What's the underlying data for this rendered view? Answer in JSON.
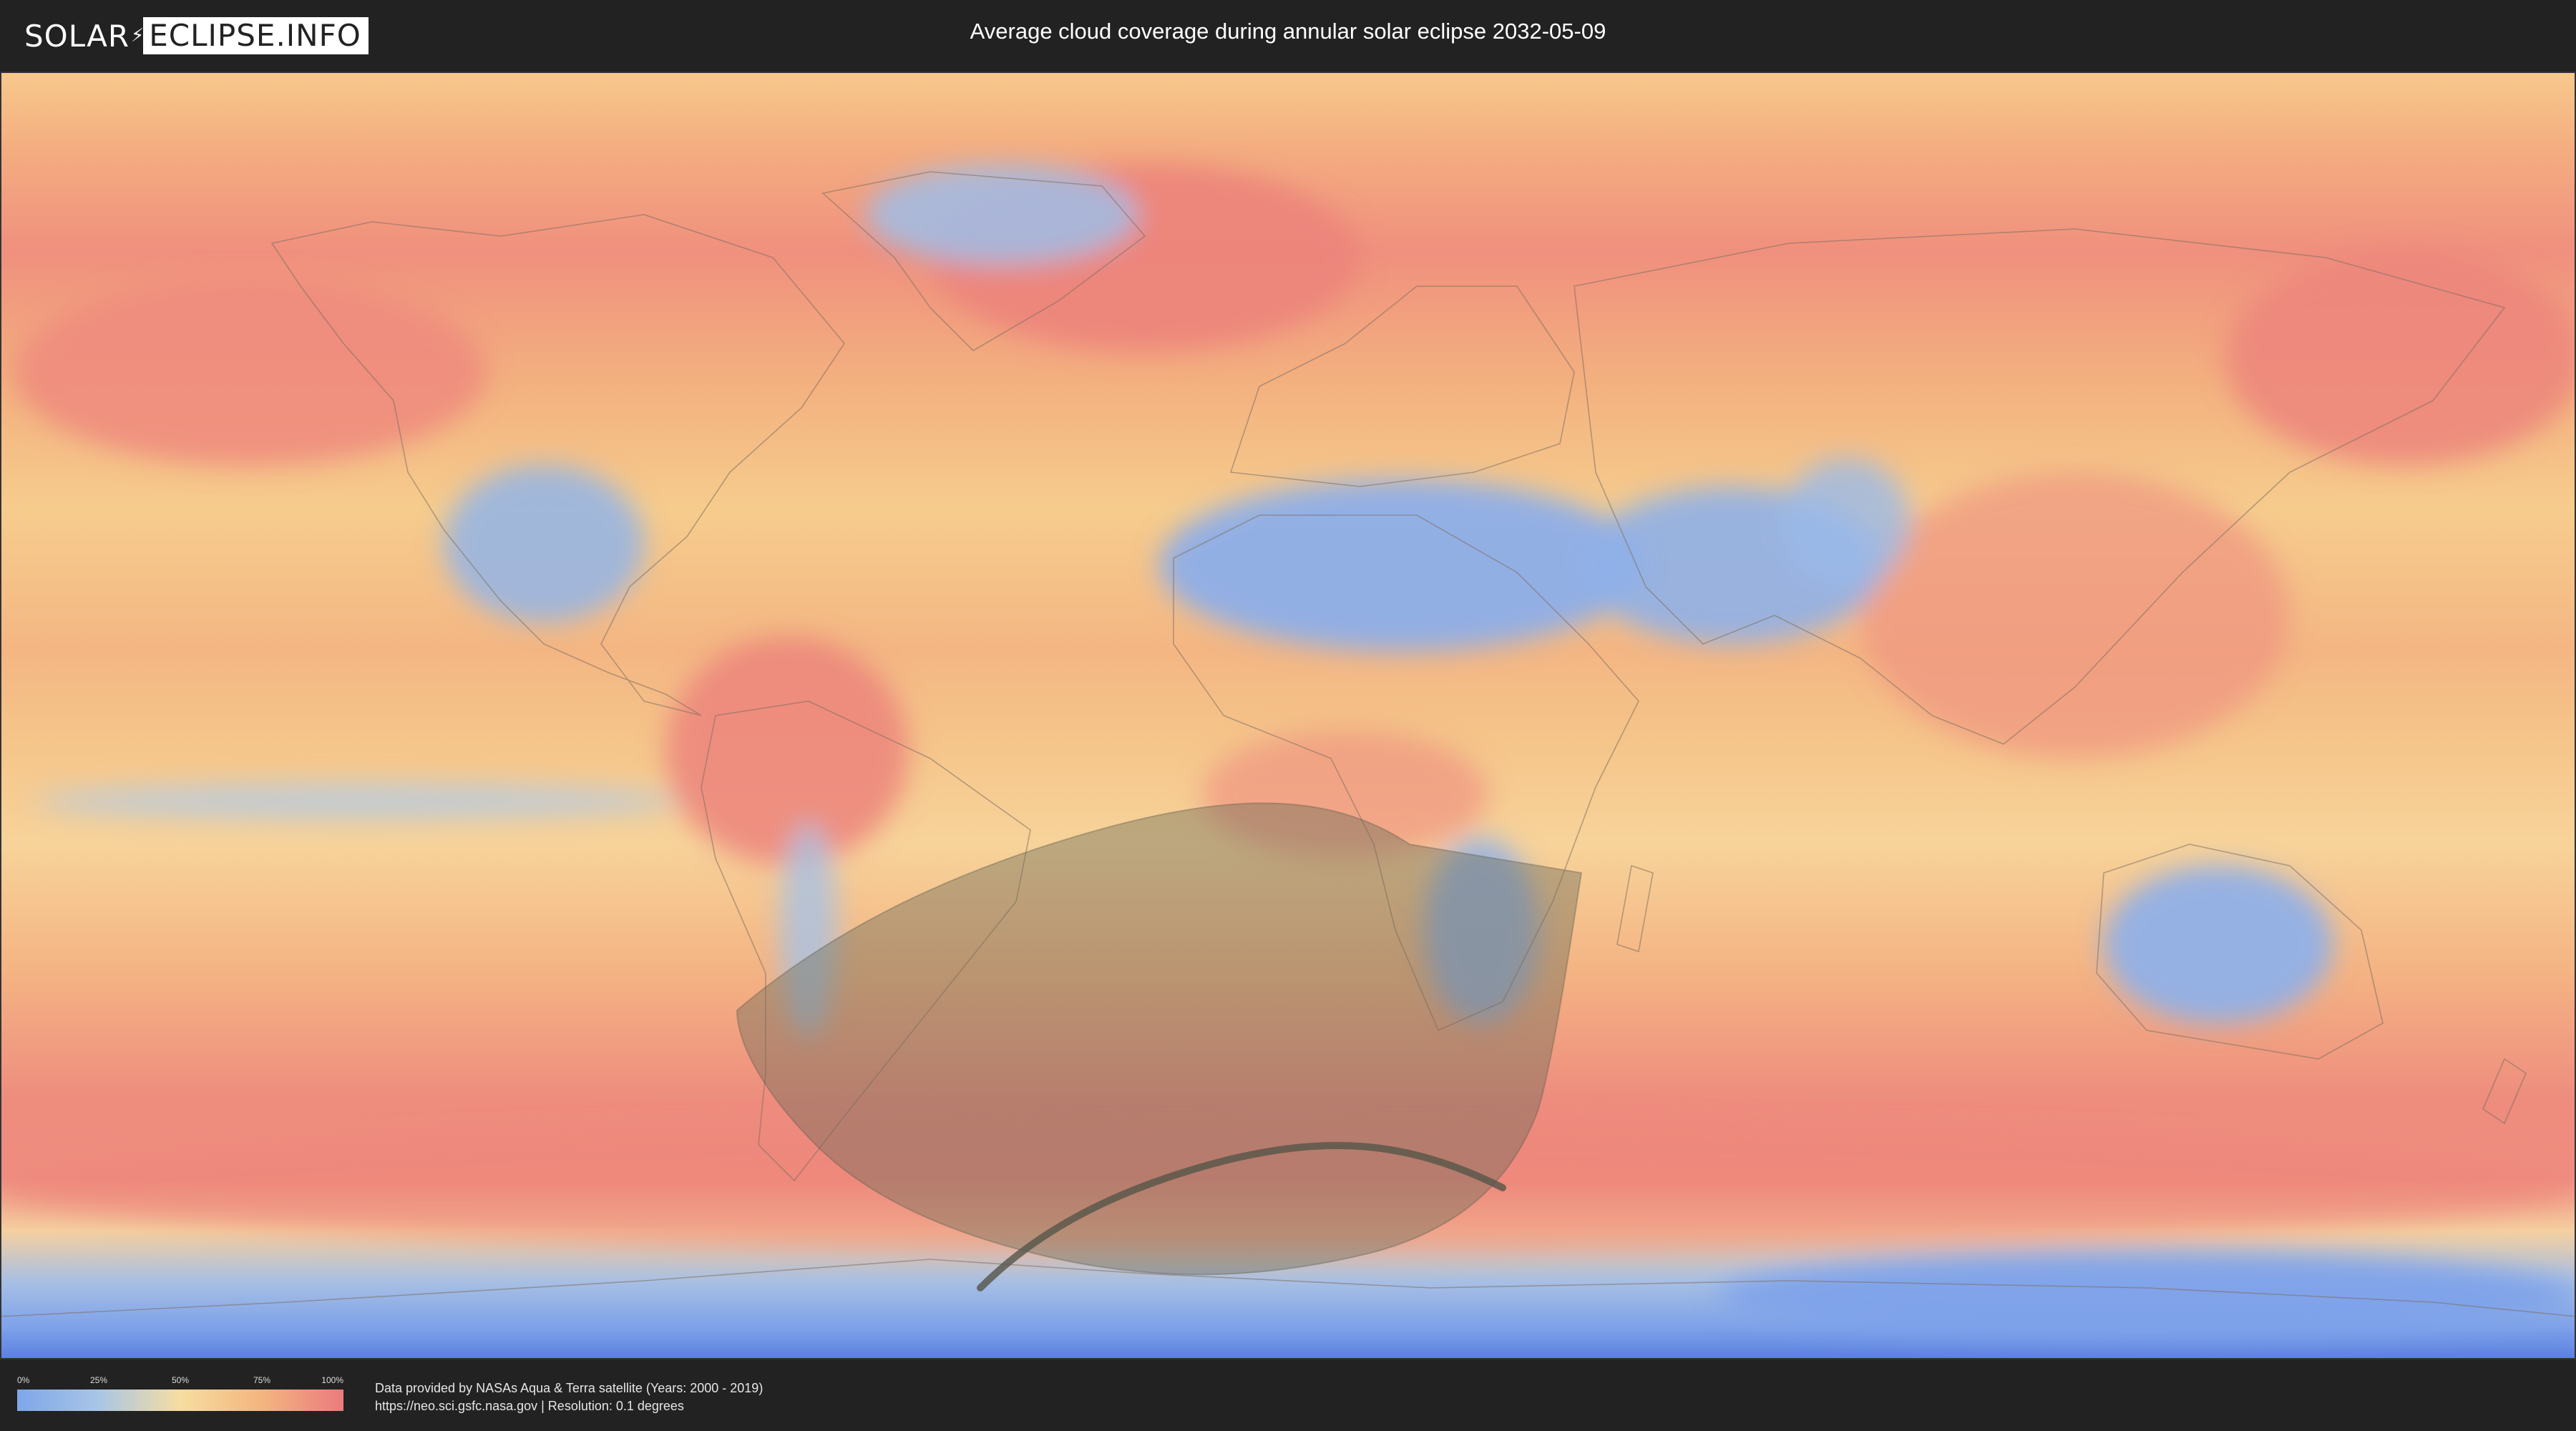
{
  "header": {
    "logo_left": "SOLAR",
    "logo_right": "ECLIPSE.INFO",
    "title": "Average cloud coverage during annular solar eclipse 2032-05-09"
  },
  "legend": {
    "ticks": [
      "0%",
      "25%",
      "50%",
      "75%",
      "100%"
    ],
    "colors": [
      "#7ea6ea",
      "#a9c6e6",
      "#f6dda0",
      "#f4b57f",
      "#ea7b7d"
    ]
  },
  "footer": {
    "source_line": "Data provided by NASAs Aqua & Terra satellite (Years: 2000 - 2019)",
    "url_line": "https://neo.sci.gsfc.nasa.gov | Resolution: 0.1 degrees"
  },
  "colors": {
    "background": "#222222",
    "ocean_cloudy": "#f0907e",
    "midrange": "#f6c68a",
    "clear_land": "#8fb0e6",
    "eclipse_zone": "#6b6b58"
  }
}
